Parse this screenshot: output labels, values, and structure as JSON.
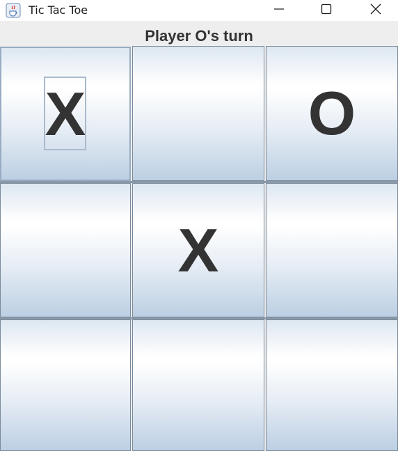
{
  "window": {
    "title": "Tic Tac Toe",
    "icon": "java-cup-icon",
    "controls": [
      "minimize-icon",
      "maximize-icon",
      "close-icon"
    ]
  },
  "status": {
    "text": "Player O's turn"
  },
  "board": {
    "cells": [
      "X",
      "",
      "O",
      "",
      "X",
      "",
      "",
      "",
      ""
    ],
    "focused_cell": 0
  },
  "colors": {
    "mark": "#333333",
    "cell_top": "#dde7f1",
    "cell_bottom": "#bccfe3",
    "grid_line": "#8a98a7"
  }
}
